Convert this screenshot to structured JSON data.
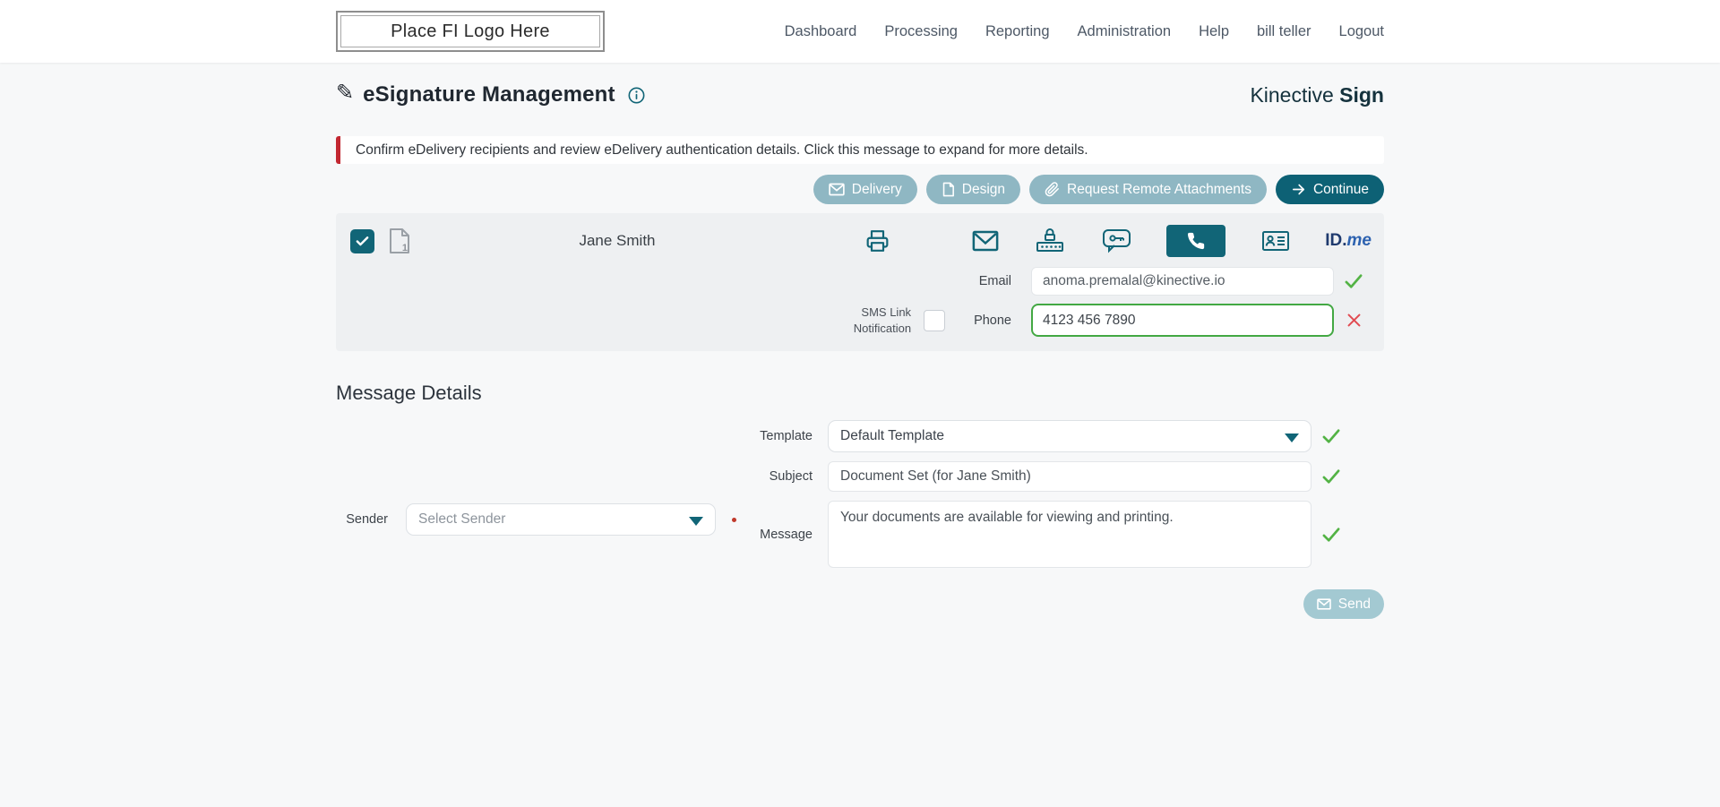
{
  "colors": {
    "accent_teal": "#116577",
    "continue_button": "#0d6175",
    "light_button": "#8fb7c3",
    "send_button": "#a3c9d2",
    "alert_border_red": "#c22731",
    "valid_green": "#53b345",
    "invalid_red": "#e14b52",
    "phone_input_border": "#43a843",
    "brand_navy": "#15323d",
    "idme_navy": "#1f3a6e",
    "idme_blue": "#2d62b0",
    "page_background": "#f7f8f9",
    "card_background": "#eef0f2"
  },
  "header": {
    "logo_placeholder": "Place FI Logo Here",
    "nav": [
      "Dashboard",
      "Processing",
      "Reporting",
      "Administration",
      "Help",
      "bill teller",
      "Logout"
    ]
  },
  "page": {
    "title": "eSignature Management",
    "brand_name": "Kinective",
    "brand_suffix": "Sign",
    "alert_message": "Confirm eDelivery recipients and review eDelivery authentication details. Click this message to expand for more details."
  },
  "toolbar": {
    "delivery_label": "Delivery",
    "design_label": "Design",
    "request_remote_label": "Request Remote Attachments",
    "continue_label": "Continue"
  },
  "recipient": {
    "name": "Jane Smith",
    "document_count": "1",
    "email_label": "Email",
    "email_value": "anoma.premalal@kinective.io",
    "sms_link_label": "SMS Link Notification",
    "phone_label": "Phone",
    "phone_value": "4123 456 7890",
    "idme_text_bold": "ID.",
    "idme_text_italic": "me"
  },
  "message_details": {
    "heading": "Message Details",
    "sender_label": "Sender",
    "sender_placeholder": "Select Sender",
    "template_label": "Template",
    "template_value": "Default Template",
    "subject_label": "Subject",
    "subject_value": "Document Set (for Jane Smith)",
    "message_label": "Message",
    "message_value": "Your documents are available for viewing and printing.",
    "send_label": "Send"
  }
}
